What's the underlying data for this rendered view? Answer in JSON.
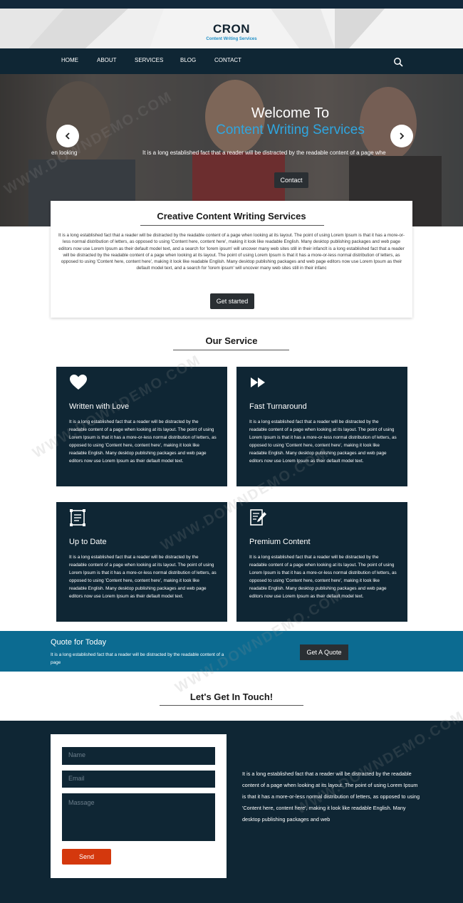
{
  "brand": {
    "title": "CRON",
    "subtitle": "Content Writing Services"
  },
  "nav": {
    "items": [
      {
        "label": "HOME"
      },
      {
        "label": "ABOUT"
      },
      {
        "label": "SERVICES"
      },
      {
        "label": "BLOG"
      },
      {
        "label": "CONTACT"
      }
    ],
    "search_icon": "search-icon"
  },
  "hero": {
    "title": "Welcome To",
    "subtitle": "Content Writing Services",
    "text_main": "It is a long established fact that a reader will be distracted by the readable content of a page whe",
    "text_left": "en looking",
    "button": "Contact",
    "prev_icon": "chevron-left-icon",
    "next_icon": "chevron-right-icon"
  },
  "intro": {
    "title": "Creative Content Writing Services",
    "text": "It is a long established fact that a reader will be distracted by the readable content of a page when looking at its layout. The point of using Lorem Ipsum is that it has a more-or-less normal distribution of letters, as opposed to using 'Content here, content here', making it look like readable English. Many desktop publishing packages and web page editors now use Lorem Ipsum as their default model text, and a search for 'lorem ipsum' will uncover many web sites still in their infancIt is a long established fact that a reader will be distracted by the readable content of a page when looking at its layout. The point of using Lorem Ipsum is that it has a more-or-less normal distribution of letters, as opposed to using 'Content here, content here', making it look like readable English. Many desktop publishing packages and web page editors now use Lorem Ipsum as their default model text, and a search for 'lorem ipsum' will uncover many web sites still in their infanc",
    "button": "Get started"
  },
  "services": {
    "title": "Our Service",
    "items": [
      {
        "title": "Written with Love",
        "icon": "heart-icon",
        "text": "It is a long established fact that a reader will be distracted by the readable content of a page when looking at its layout. The point of using Lorem Ipsum is that it has a more-or-less normal distribution of letters, as opposed to using 'Content here, content here', making it look like readable English. Many desktop publishing packages and web page editors now use Lorem Ipsum as their default model text."
      },
      {
        "title": "Fast Turnaround",
        "icon": "fast-forward-icon",
        "text": "It is a long established fact that a reader will be distracted by the readable content of a page when looking at its layout. The point of using Lorem Ipsum is that it has a more-or-less normal distribution of letters, as opposed to using 'Content here, content here', making it look like readable English. Many desktop publishing packages and web page editors now use Lorem Ipsum as their default model text."
      },
      {
        "title": "Up to Date",
        "icon": "document-frame-icon",
        "text": "It is a long established fact that a reader will be distracted by the readable content of a page when looking at its layout. The point of using Lorem Ipsum is that it has a more-or-less normal distribution of letters, as opposed to using 'Content here, content here', making it look like readable English. Many desktop publishing packages and web page editors now use Lorem Ipsum as their default model text."
      },
      {
        "title": "Premium Content",
        "icon": "document-edit-icon",
        "text": "It is a long established fact that a reader will be distracted by the readable content of a page when looking at its layout. The point of using Lorem Ipsum is that it has a more-or-less normal distribution of letters, as opposed to using 'Content here, content here', making it look like readable English. Many desktop publishing packages and web page editors now use Lorem Ipsum as their default model text."
      }
    ]
  },
  "quote": {
    "title": "Quote for Today",
    "text": "It is a long established fact that a reader will be distracted by the readable content of a page",
    "button": "Get A Quote"
  },
  "contact": {
    "title": "Let's Get In Touch!",
    "name_placeholder": "Name",
    "email_placeholder": "Email",
    "message_placeholder": "Massage",
    "send": "Send",
    "text": "It is a long established fact that a reader will be distracted by the readable content of a page when looking at its layout. The point of using Lorem Ipsum is that it has a more-or-less normal distribution of letters, as opposed to using 'Content here, content here', making it look like readable English. Many desktop publishing packages and web"
  },
  "watermark": "WWW.DOWNDEMO.COM",
  "colors": {
    "navy": "#0f2634",
    "accent_blue": "#2fa6e0",
    "quote_band": "#0c6b91",
    "send_button": "#d4380d",
    "dark_button": "#2a2f33"
  }
}
